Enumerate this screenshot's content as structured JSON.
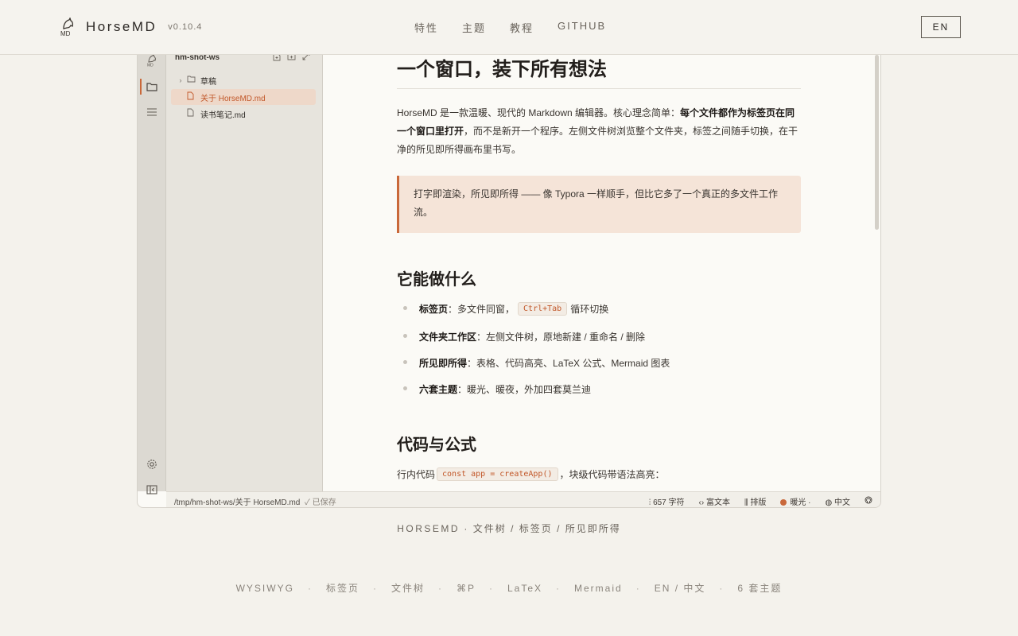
{
  "header": {
    "brand_name": "HorseMD",
    "version": "v0.10.4",
    "nav": [
      "特性",
      "主题",
      "教程",
      "GITHUB"
    ],
    "lang_button": "EN"
  },
  "app": {
    "sidebar": {
      "workspace": "hm-shot-ws",
      "tree": [
        {
          "label": "草稿",
          "type": "folder"
        },
        {
          "label": "关于 HorseMD.md",
          "type": "file",
          "selected": true
        },
        {
          "label": "读书笔记.md",
          "type": "file"
        }
      ]
    },
    "doc": {
      "h1": "一个窗口，装下所有想法",
      "p1_a": "HorseMD 是一款温暖、现代的 Markdown 编辑器。核心理念简单：",
      "p1_b": "每个文件都作为标签页在同一个窗口里打开",
      "p1_c": "，而不是新开一个程序。左侧文件树浏览整个文件夹，标签之间随手切换，在干净的所见即所得画布里书写。",
      "quote": "打字即渲染，所见即所得 —— 像 Typora 一样顺手，但比它多了一个真正的多文件工作流。",
      "h2_features": "它能做什么",
      "features": [
        {
          "term": "标签页",
          "desc_a": "：多文件同窗，",
          "kbd": "Ctrl+Tab",
          "desc_b": " 循环切换"
        },
        {
          "term": "文件夹工作区",
          "desc_a": "：左侧文件树，原地新建 / 重命名 / 删除"
        },
        {
          "term": "所见即所得",
          "desc_a": "：表格、代码高亮、LaTeX 公式、Mermaid 图表"
        },
        {
          "term": "六套主题",
          "desc_a": "：暖光、暖夜，外加四套莫兰迪"
        }
      ],
      "h2_code": "代码与公式",
      "p2_a": "行内代码",
      "p2_code": "const app = createApp()",
      "p2_b": "，块级代码带语法高亮："
    },
    "status": {
      "path": "/tmp/hm-shot-ws/关于 HorseMD.md",
      "saved": "✓ 已保存",
      "words": "657 字符",
      "mode": "富文本",
      "layout": "排版",
      "theme": "暖光 ·",
      "lang": "中文"
    }
  },
  "caption": {
    "brand": "HORSEMD",
    "text": " · 文件树 / 标签页 / 所见即所得"
  },
  "footer": {
    "items": [
      "WYSIWYG",
      "标签页",
      "文件树",
      "⌘P",
      "LaTeX",
      "Mermaid",
      "EN / 中文",
      "6 套主题"
    ]
  },
  "colors": {
    "accent": "#c9683a",
    "background": "#f4f2ec",
    "sidebar": "#e7e4dd",
    "rail": "#dcd9d2",
    "quote_bg": "#f5e4d8"
  },
  "icons": {
    "rail": [
      "logo-icon",
      "folder-icon",
      "list-icon",
      "gear-icon",
      "sidebar-toggle-icon"
    ],
    "sidebar_tools": [
      "new-file-icon",
      "new-folder-icon",
      "collapse-icon"
    ],
    "status": [
      "chart-icon",
      "code-icon",
      "layout-icon",
      "globe-icon",
      "github-icon"
    ]
  }
}
